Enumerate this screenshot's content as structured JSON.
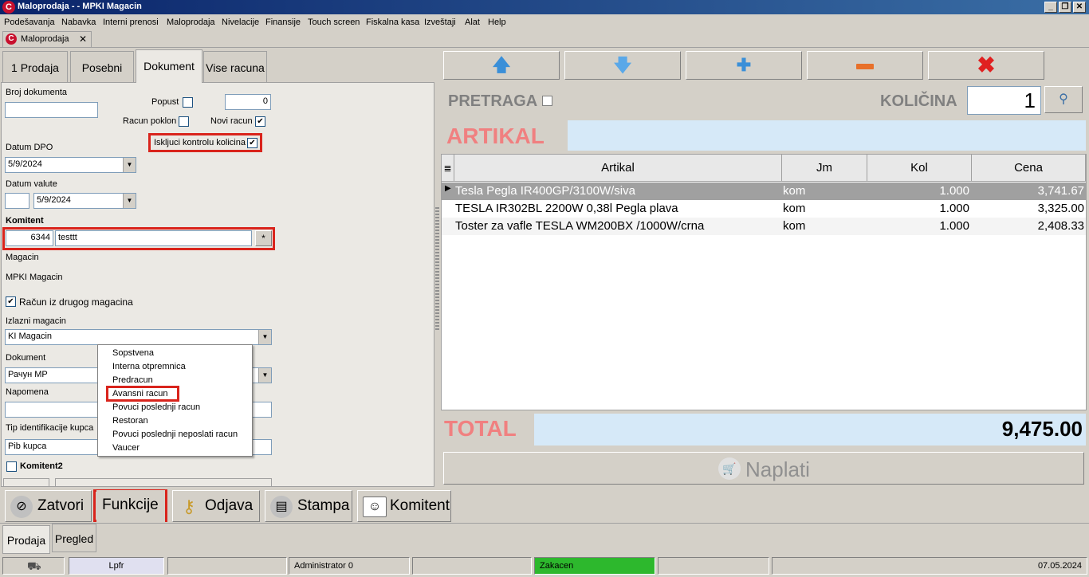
{
  "window": {
    "title": "Maloprodaja - - MPKI Magacin",
    "app_icon": "C"
  },
  "menu": [
    "Podešavanja",
    "Nabavka",
    "Interni prenosi",
    "Maloprodaja",
    "Nivelacije",
    "Finansije",
    "Touch screen",
    "Fiskalna kasa",
    "Izveštaji",
    "Alat",
    "Help"
  ],
  "doc_tab": {
    "label": "Maloprodaja",
    "close": "✕"
  },
  "tabs": [
    "1 Prodaja",
    "Posebni",
    "Dokument",
    "Vise racuna"
  ],
  "form": {
    "broj_dokumenta_label": "Broj dokumenta",
    "broj_dokumenta_value": "",
    "popust_label": "Popust",
    "popust_value": "0",
    "racun_poklon_label": "Racun poklon",
    "novi_racun_label": "Novi racun",
    "iskljuci_label": "Iskljuci kontrolu kolicina",
    "datum_dpo_label": "Datum DPO",
    "datum_dpo_value": "5/9/2024",
    "datum_valute_label": "Datum valute",
    "datum_valute_days": "",
    "datum_valute_value": "5/9/2024",
    "komitent_label": "Komitent",
    "komitent_id": "6344",
    "komitent_name": "testtt",
    "komitent_btn": "*",
    "magacin_label": "Magacin",
    "magacin_value": "MPKI Magacin",
    "racun_iz_drugog_label": "Račun iz drugog magacina",
    "izlazni_magacin_label": "Izlazni magacin",
    "izlazni_magacin_value": "KI Magacin",
    "dokument_label": "Dokument",
    "dokument_value": "Рачун МР",
    "napomena_label": "Napomena",
    "tip_identifikacije_label": "Tip identifikacije kupca",
    "tip_identifikacije_value": "Pib kupca",
    "komitent2_label": "Komitent2"
  },
  "dropdown": [
    "Sopstvena",
    "Interna otpremnica",
    "Predracun",
    "Avansni racun",
    "Povuci poslednji racun",
    "Restoran",
    "Povuci poslednji neposlati racun",
    "Vaucer"
  ],
  "bottom_buttons": {
    "zatvori": "Zatvori",
    "funkcije": "Funkcije",
    "odjava": "Odjava",
    "stampa": "Stampa",
    "komitent": "Komitent"
  },
  "bottom_tabs": [
    "Prodaja",
    "Pregled"
  ],
  "status": {
    "lpfr": "Lpfr",
    "user": "Administrator 0",
    "state": "Zakacen",
    "date": "07.05.2024"
  },
  "right": {
    "pretraga_label": "PRETRAGA",
    "kolicina_label": "KOLIČINA",
    "kolicina_value": "1",
    "artikal_label": "ARTIKAL",
    "artikal_value": "",
    "total_label": "TOTAL",
    "total_value": "9,475.00",
    "naplati_label": "Naplati"
  },
  "grid": {
    "headers": [
      "Artikal",
      "Jm",
      "Kol",
      "Cena"
    ],
    "rows": [
      [
        "Tesla Pegla IR400GP/3100W/siva",
        "kom",
        "1.000",
        "3,741.67"
      ],
      [
        "TESLA IR302BL 2200W 0,38l Pegla plava",
        "kom",
        "1.000",
        "3,325.00"
      ],
      [
        "Toster za vafle TESLA WM200BX /1000W/crna",
        "kom",
        "1.000",
        "2,408.33"
      ]
    ]
  },
  "colors": {
    "accent_red": "#d9241c",
    "label_pink": "#f08080",
    "field_blue": "#d6e9f8",
    "status_green": "#2db82d"
  }
}
